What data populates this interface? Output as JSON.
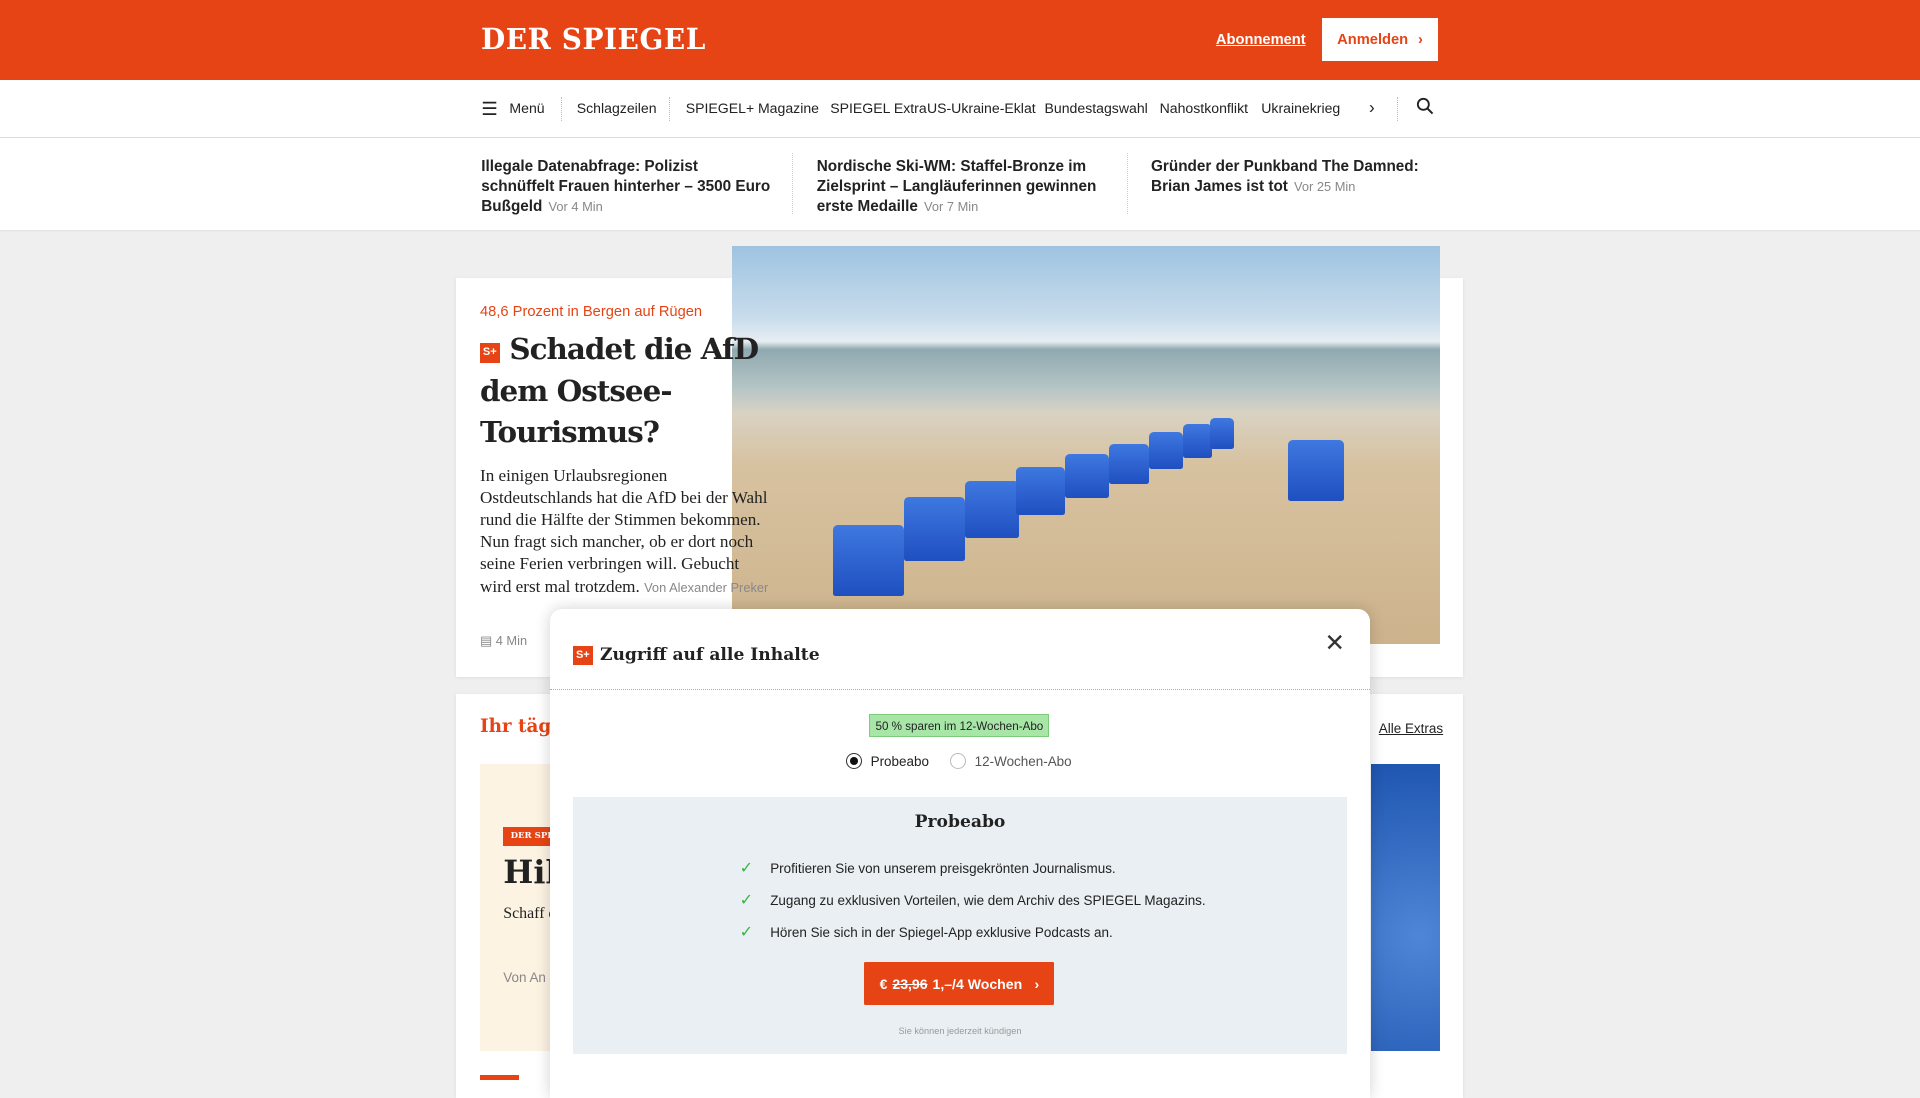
{
  "header": {
    "logo": "DER SPIEGEL",
    "subscription_link": "Abonnement",
    "login_button": "Anmelden",
    "accent": "#e64415"
  },
  "nav": {
    "menu": "Menü",
    "items": [
      "Schlagzeilen",
      "SPIEGEL+",
      "Magazine",
      "SPIEGEL Extra",
      "US-Ukraine-Eklat",
      "Bundestagswahl",
      "Nahostkonflikt",
      "Ukrainekrieg"
    ]
  },
  "teasers": [
    {
      "title": "Illegale Datenabfrage: Polizist schnüffelt Frauen hinterher – 3500 Euro Bußgeld",
      "time": "Vor 4 Min"
    },
    {
      "title": "Nordische Ski-WM: Staffel-Bronze im Zielsprint – Langläuferinnen gewinnen erste Medaille",
      "time": "Vor 7 Min"
    },
    {
      "title": "Gründer der Punkband The Damned: Brian James ist tot",
      "time": "Vor 25 Min"
    }
  ],
  "main_article": {
    "kicker": "48,6 Prozent in Bergen auf Rügen",
    "badge": "S+",
    "headline": "Schadet die AfD dem Ostsee-Tourismus?",
    "text": "In einigen Urlaubsregionen Ostdeutschlands hat die AfD bei der Wahl rund die Hälfte der Stimmen bekommen. Nun fragt sich mancher, ob er dort noch seine Ferien verbringen will. Gebucht wird erst mal trotzdem.",
    "byline": "Von Alexander Preker",
    "read_time": "4 Min"
  },
  "extras": {
    "heading": "Ihr täglic",
    "all_link": "Alle Extras",
    "mag_badge": "DER SPIE",
    "mag_title": "Hil",
    "mag_text": "Schaff die Fri aufstei",
    "mag_by": "Von An"
  },
  "modal": {
    "badge": "S+",
    "title": "Zugriff auf alle Inhalte",
    "savings_badge": "50 % sparen im 12-Wochen-Abo",
    "options": [
      {
        "label": "Probeabo",
        "selected": true
      },
      {
        "label": "12-Wochen-Abo",
        "selected": false
      }
    ],
    "panel_title": "Probeabo",
    "features": [
      "Profitieren Sie von unserem preisgekrönten Journalismus.",
      "Zugang zu exklusiven Vorteilen, wie dem Archiv des SPIEGEL Magazins.",
      "Hören Sie sich in der Spiegel-App exklusive Podcasts an."
    ],
    "cta_currency": "€",
    "cta_old_price": "23,96",
    "cta_price": "1,–/4 Wochen",
    "cancel_note": "Sie können jederzeit kündigen"
  }
}
